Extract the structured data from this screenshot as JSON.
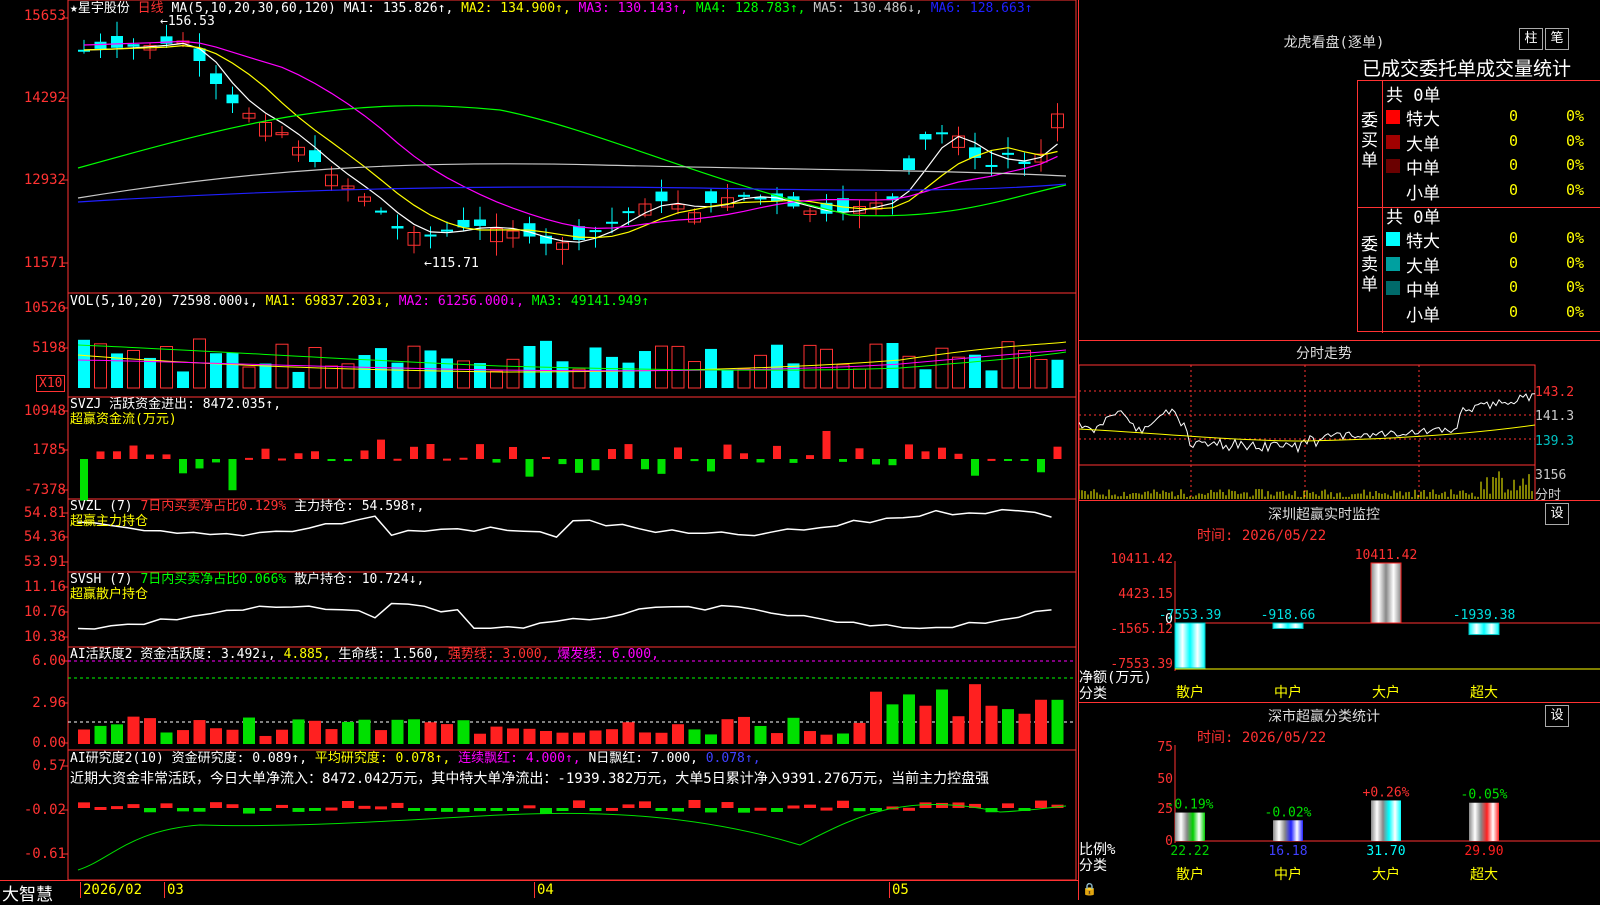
{
  "chart": {
    "stock_name": "星宇股份",
    "star": "★",
    "period": "日线",
    "high_marker": "156.53",
    "low_marker": "115.71",
    "ma_header": [
      {
        "text": "MA(5,10,20,30,60,120)",
        "color": "#ffffff"
      },
      {
        "text": "MA1: 135.826↑,",
        "color": "#ffffff"
      },
      {
        "text": "MA2: 134.900↑,",
        "color": "#ffff00"
      },
      {
        "text": "MA3: 130.143↑,",
        "color": "#ff00ff"
      },
      {
        "text": "MA4: 128.783↑,",
        "color": "#00ff00"
      },
      {
        "text": "MA5: 130.486↓,",
        "color": "#c8c8c8"
      },
      {
        "text": "MA6: 128.663↑",
        "color": "#2020ff"
      }
    ],
    "price_axis": [
      "15653",
      "14292",
      "12932",
      "11571"
    ],
    "vol_header": [
      {
        "text": "VOL(5,10,20)",
        "color": "#ffffff"
      },
      {
        "text": "72598.000↓,",
        "color": "#ffffff"
      },
      {
        "text": "MA1: 69837.203↓,",
        "color": "#ffff00"
      },
      {
        "text": "MA2: 61256.000↓,",
        "color": "#ff00ff"
      },
      {
        "text": "MA3: 49141.949↑",
        "color": "#00ff00"
      }
    ],
    "vol_axis": [
      "10526",
      "5198"
    ],
    "vol_unit": "X10",
    "svzj_header": [
      {
        "text": "SVZJ  活跃资金进出: 8472.035↑,",
        "color": "#ffffff"
      }
    ],
    "svzj_sub": "超赢资金流(万元)",
    "svzj_axis": [
      "10948",
      "1785",
      "-7378"
    ],
    "svzl_header": [
      {
        "text": "SVZL (7)",
        "color": "#ffffff"
      },
      {
        "text": "7日内买卖净占比0.129%",
        "color": "#ff3232"
      },
      {
        "text": "主力持仓: 54.598↑,",
        "color": "#ffffff"
      }
    ],
    "svzl_sub": "超赢主力持仓",
    "svzl_axis": [
      "54.81",
      "54.36",
      "53.91"
    ],
    "svsh_header": [
      {
        "text": "SVSH (7)",
        "color": "#ffffff"
      },
      {
        "text": "7日内买卖净占比0.066%",
        "color": "#00ff00"
      },
      {
        "text": "散户持仓: 10.724↓,",
        "color": "#ffffff"
      }
    ],
    "svsh_sub": "超赢散户持仓",
    "svsh_axis": [
      "11.16",
      "10.76",
      "10.38"
    ],
    "ai_header": [
      {
        "text": "AI活跃度2 资金活跃度: 3.492↓,",
        "color": "#ffffff"
      },
      {
        "text": "4.885,",
        "color": "#ffff00"
      },
      {
        "text": "生命线: 1.560,",
        "color": "#ffffff"
      },
      {
        "text": "强势线: 3.000,",
        "color": "#ff3232"
      },
      {
        "text": "爆发线: 6.000,",
        "color": "#ff00ff"
      }
    ],
    "ai_axis": [
      "6.00",
      "2.96",
      "0.00"
    ],
    "air_header": [
      {
        "text": "AI研究度2(10) 资金研究度: 0.089↑,",
        "color": "#ffffff"
      },
      {
        "text": "平均研究度: 0.078↑,",
        "color": "#ffff00"
      },
      {
        "text": "连续飘红: 4.000↑,",
        "color": "#ff00ff"
      },
      {
        "text": "N日飘红: 7.000,",
        "color": "#ffffff"
      },
      {
        "text": "0.078↑,",
        "color": "#4040ff"
      }
    ],
    "air_note": "近期大资金非常活跃，今日大单净流入：8472.042万元，其中特大单净流出：-1939.382万元，大单5日累计净入9391.276万元，当前主力控盘强",
    "air_axis": [
      "0.57",
      "-0.02",
      "-0.61"
    ],
    "date_axis": [
      "2026/02",
      "03",
      "04",
      "05"
    ],
    "brand": "大智慧"
  },
  "dragon": {
    "title": "龙虎看盘(逐单)",
    "btn1": "柱",
    "btn2": "笔",
    "subtitle": "已成交委托单成交量统计",
    "buy_label": "委买单",
    "sell_label": "委卖单",
    "buy_total": "共 0单",
    "sell_total": "共 0单",
    "buy_rows": [
      {
        "label": "特大",
        "count": "0",
        "pct": "0%",
        "color": "#ff0000"
      },
      {
        "label": "大单",
        "count": "0",
        "pct": "0%",
        "color": "#a00000"
      },
      {
        "label": "中单",
        "count": "0",
        "pct": "0%",
        "color": "#6a0000"
      },
      {
        "label": "小单",
        "count": "0",
        "pct": "0%",
        "color": "#000000"
      }
    ],
    "sell_rows": [
      {
        "label": "特大",
        "count": "0",
        "pct": "0%",
        "color": "#00ffff"
      },
      {
        "label": "大单",
        "count": "0",
        "pct": "0%",
        "color": "#00a0a0"
      },
      {
        "label": "中单",
        "count": "0",
        "pct": "0%",
        "color": "#006a6a"
      },
      {
        "label": "小单",
        "count": "0",
        "pct": "0%",
        "color": "#000000"
      }
    ]
  },
  "intraday": {
    "title": "分时走势",
    "axis": [
      "143.2",
      "141.3",
      "139.3"
    ],
    "vol_val": "3156",
    "vol_unit": "分时"
  },
  "monitor": {
    "title": "深圳超赢实时监控",
    "btn": "设",
    "time": "时间: 2026/05/22",
    "axis": [
      "10411.42",
      "4423.15",
      "0",
      "-1565.12",
      "-7553.39"
    ],
    "unit": "净额(万元)",
    "cat_label": "分类",
    "chart_data": {
      "type": "bar",
      "categories": [
        "散户",
        "中户",
        "大户",
        "超大"
      ],
      "values": [
        -7553.39,
        -918.66,
        10411.42,
        -1939.38
      ],
      "value_labels": [
        "-7553.39",
        "-918.66",
        "10411.42",
        "-1939.38"
      ],
      "ylim": [
        -7553.39,
        10411.42
      ]
    }
  },
  "classify": {
    "title": "深市超赢分类统计",
    "btn": "设",
    "time": "时间: 2026/05/22",
    "axis": [
      "75",
      "50",
      "25",
      "0"
    ],
    "unit": "比例%",
    "cat_label": "分类",
    "chart_data": {
      "type": "bar",
      "categories": [
        "散户",
        "中户",
        "大户",
        "超大"
      ],
      "values": [
        22.22,
        16.18,
        31.7,
        29.9
      ],
      "value_labels": [
        "22.22",
        "16.18",
        "31.70",
        "29.90"
      ],
      "changes": [
        "-0.19%",
        "-0.02%",
        "+0.26%",
        "-0.05%"
      ],
      "ylim": [
        0,
        75
      ],
      "colors": [
        "#00d000",
        "#2020ff",
        "#00ffff",
        "#ff2020"
      ]
    }
  }
}
